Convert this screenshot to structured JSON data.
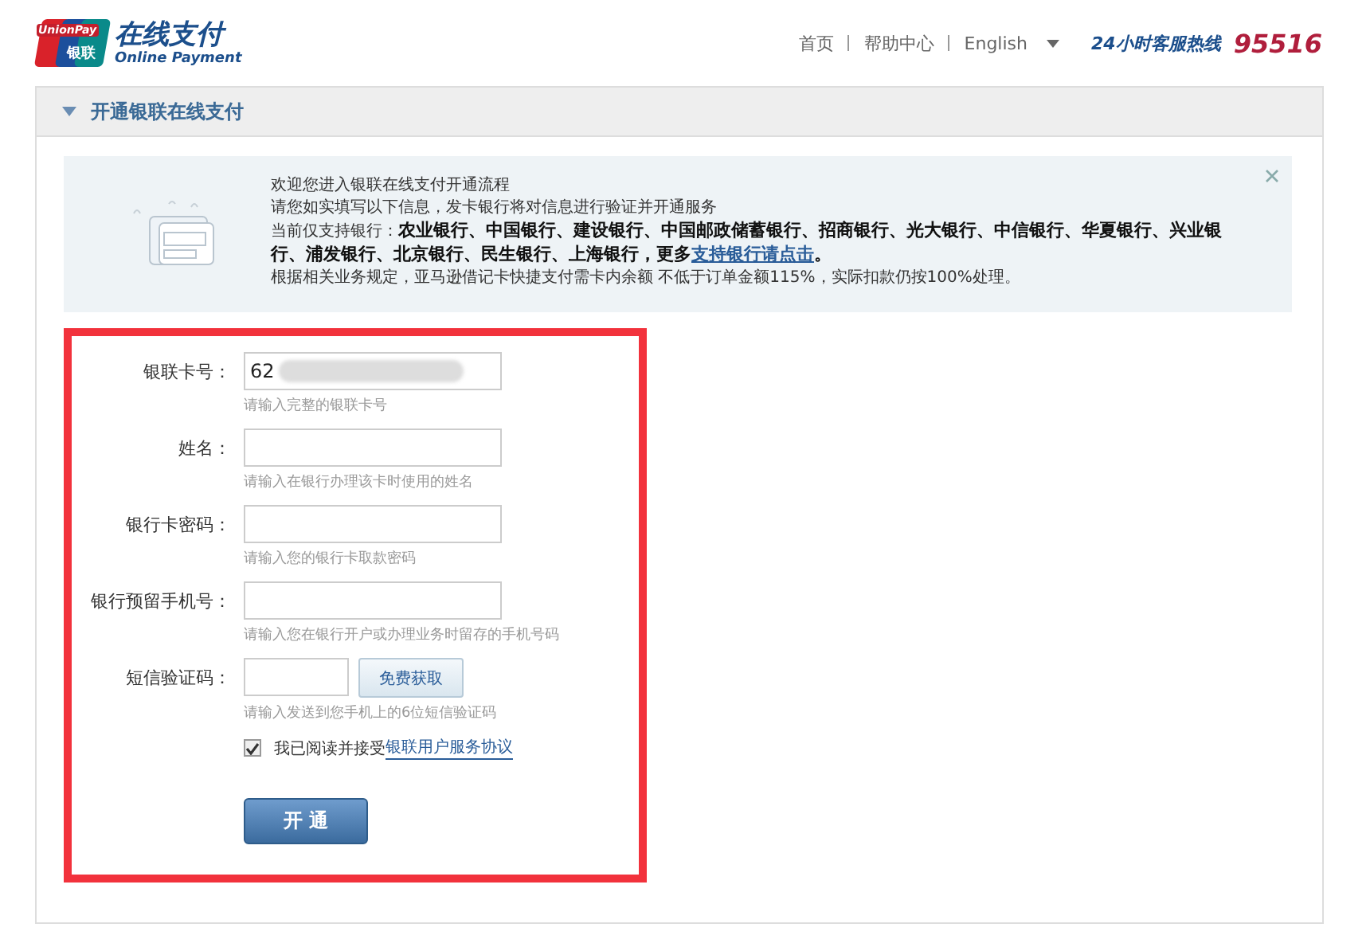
{
  "header": {
    "logo": {
      "badge_top": "UnionPay",
      "badge_bottom": "银联",
      "title": "在线支付",
      "subtitle": "Online Payment"
    },
    "nav": [
      {
        "label": "首页"
      },
      {
        "label": "帮助中心"
      },
      {
        "label": "English",
        "dropdown": true
      }
    ],
    "hotline_label": "24小时客服热线",
    "hotline_number": "95516"
  },
  "panel": {
    "title": "开通银联在线支付",
    "expanded": true
  },
  "notice": {
    "closable": true,
    "lines": [
      {
        "text": "欢迎您进入银联在线支付开通流程"
      },
      {
        "text": "请您如实填写以下信息，发卡银行将对信息进行验证并开通服务"
      },
      {
        "prefix": "当前仅支持银行：",
        "bold": "农业银行、中国银行、建设银行、中国邮政储蓄银行、招商银行、光大银行、中信银行、华夏银行、兴业银行、浦发银行、北京银行、民生银行、上海银行，更多",
        "link": "支持银行请点击",
        "suffix": "。"
      },
      {
        "text": "根据相关业务规定，亚马逊借记卡快捷支付需卡内余额 不低于订单金额115%，实际扣款仍按100%处理。"
      }
    ]
  },
  "fields": [
    {
      "kind": "text",
      "label": "银联卡号：",
      "value": "62",
      "redacted": true,
      "hint": "请输入完整的银联卡号"
    },
    {
      "kind": "text",
      "label": "姓名：",
      "hint": "请输入在银行办理该卡时使用的姓名"
    },
    {
      "kind": "text",
      "label": "银行卡密码：",
      "hint": "请输入您的银行卡取款密码"
    },
    {
      "kind": "text",
      "label": "银行预留手机号：",
      "hint": "请输入您在银行开户或办理业务时留存的手机号码"
    },
    {
      "kind": "code",
      "label": "短信验证码：",
      "button": "免费获取",
      "hint": "请输入发送到您手机上的6位短信验证码"
    }
  ],
  "agreement": {
    "checked": true,
    "text": "我已阅读并接受",
    "link": "银联用户服务协议"
  },
  "submit": "开 通"
}
